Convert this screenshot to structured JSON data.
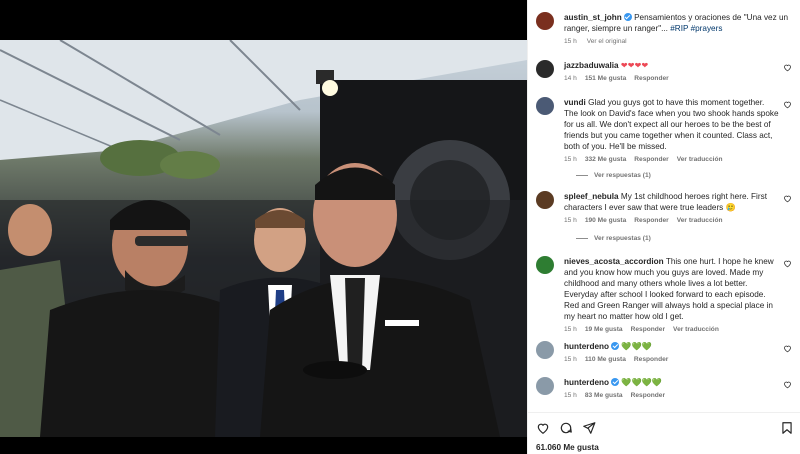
{
  "post": {
    "author": "austin_st_john",
    "caption": "Pensamientos y oraciones de \"Una vez un ranger, siempre un ranger\"...",
    "hashtags": "#RIP #prayers",
    "time": "15 h",
    "see_original": "Ver el original"
  },
  "comments": [
    {
      "user": "jazzbaduwalia",
      "text": "❤❤❤❤",
      "time": "14 h",
      "likes": "151 Me gusta",
      "reply": "Responder",
      "translate": ""
    },
    {
      "user": "vundi",
      "text": "Glad you guys got to have this moment together. The look on David's face when you two shook hands spoke for us all. We don't expect all our heroes to be the best of friends but you came together when it counted. Class act, both of you. He'll be missed.",
      "time": "15 h",
      "likes": "332 Me gusta",
      "reply": "Responder",
      "translate": "Ver traducción"
    },
    {
      "user": "spleef_nebula",
      "text": "My 1st childhood heroes right here. First characters I ever saw that were true leaders 🥲",
      "time": "15 h",
      "likes": "190 Me gusta",
      "reply": "Responder",
      "translate": "Ver traducción"
    },
    {
      "user": "nieves_acosta_accordion",
      "text": "This one hurt. I hope he knew and you know how much you guys are loved. Made my childhood and many others whole lives a lot better. Everyday after school I looked forward to each episode. Red and Green Ranger will always hold a special place in my heart no matter how old I get.",
      "time": "15 h",
      "likes": "19 Me gusta",
      "reply": "Responder",
      "translate": "Ver traducción"
    },
    {
      "user": "hunterdeno",
      "text": "💚💚💚",
      "time": "15 h",
      "likes": "110 Me gusta",
      "reply": "Responder",
      "translate": ""
    },
    {
      "user": "hunterdeno",
      "text": "💚💚💚💚",
      "time": "15 h",
      "likes": "83 Me gusta",
      "reply": "Responder",
      "translate": ""
    }
  ],
  "view_replies": [
    "Ver respuestas (1)",
    "Ver respuestas (1)"
  ],
  "likes_total": "61.060 Me gusta",
  "icons": [
    "heart-icon",
    "comment-icon",
    "share-icon",
    "bookmark-icon",
    "verified-badge-icon"
  ],
  "colors": {
    "accent": "#3897f0",
    "heart": "#ed4956",
    "text": "#262626",
    "muted": "#737373",
    "link": "#00376b"
  }
}
